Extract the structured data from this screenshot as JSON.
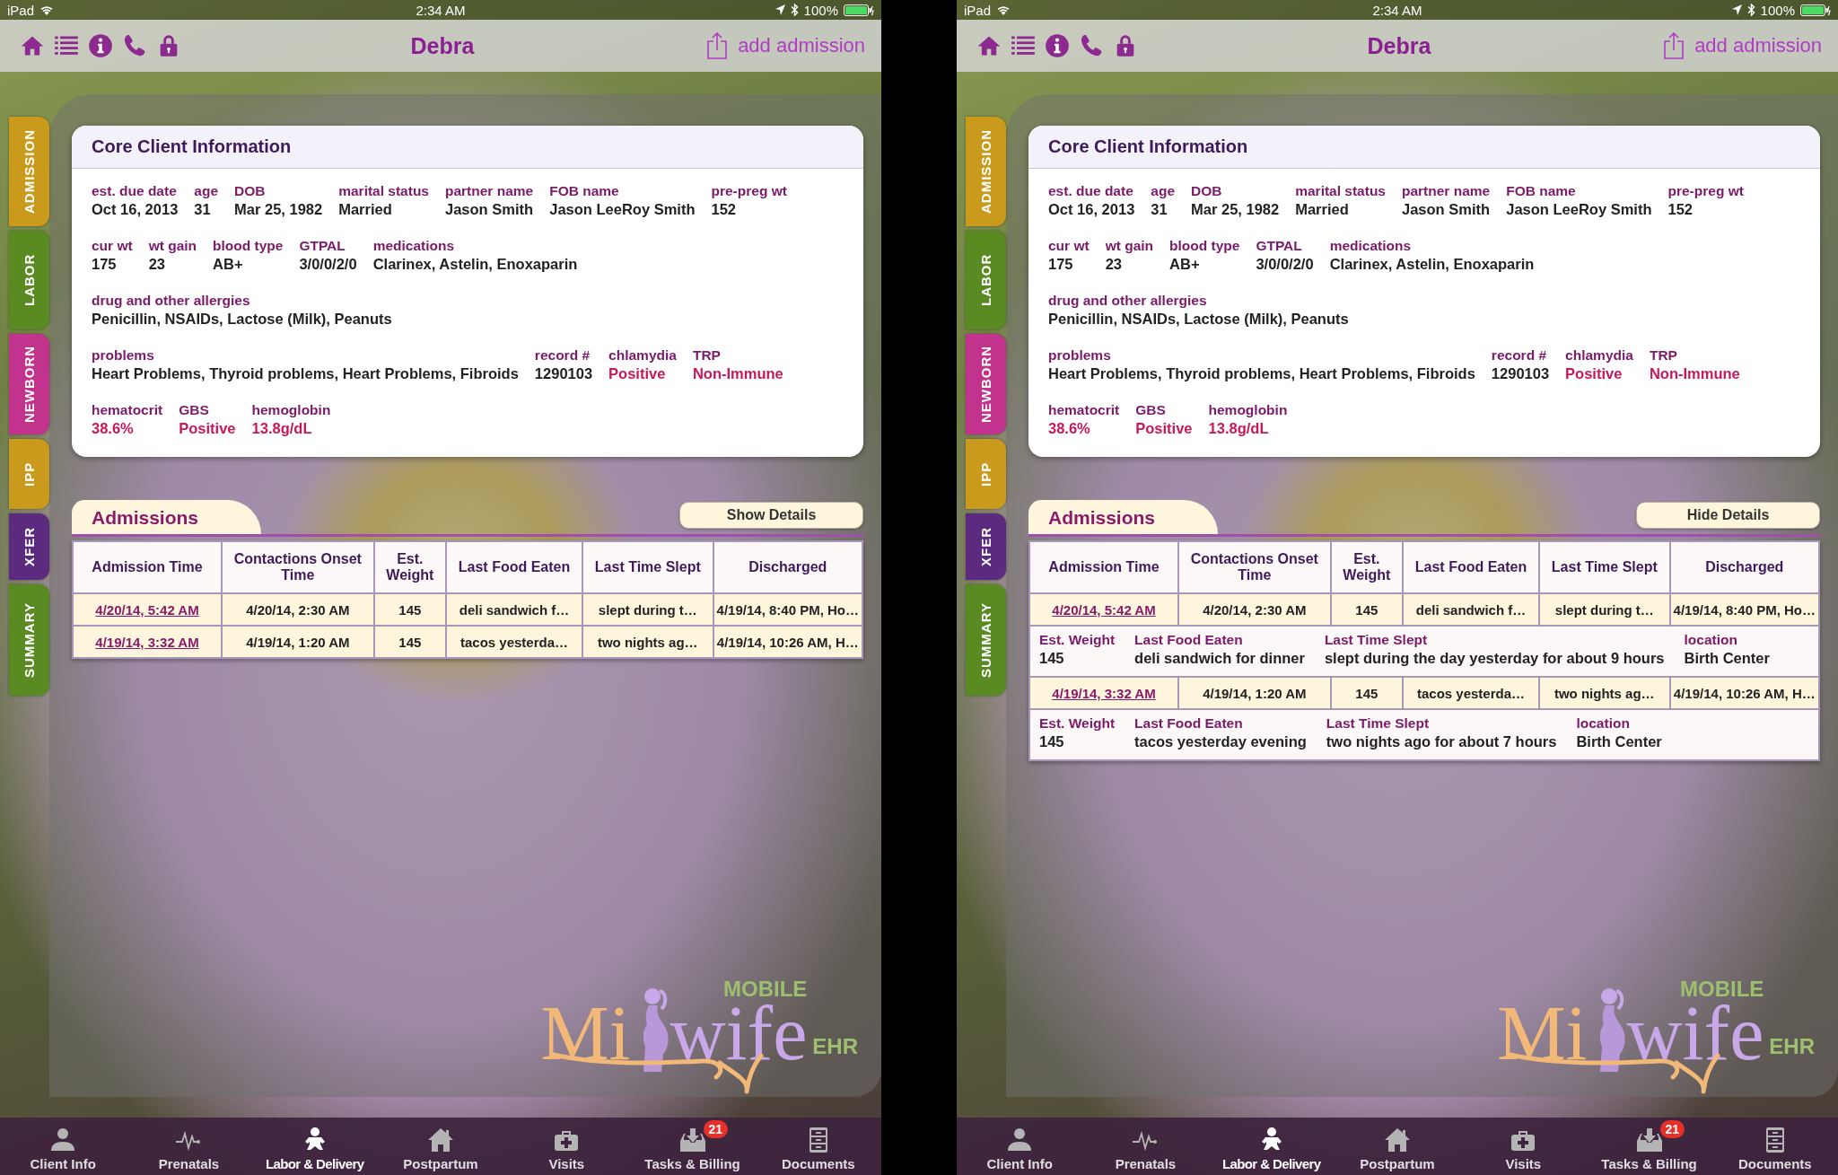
{
  "screens": [
    {
      "status_bar": {
        "device": "iPad",
        "time": "2:34 AM",
        "battery": "100%"
      },
      "nav": {
        "title": "Debra",
        "action": "add admission"
      },
      "side_tabs": [
        {
          "label": "ADMISSION",
          "color": "#c99a1c"
        },
        {
          "label": "LABOR",
          "color": "#5a8a22"
        },
        {
          "label": "NEWBORN",
          "color": "#c2338e"
        },
        {
          "label": "IPP",
          "color": "#c99a1c"
        },
        {
          "label": "XFER",
          "color": "#5c2a7e"
        },
        {
          "label": "SUMMARY",
          "color": "#5a8a22"
        }
      ],
      "core": {
        "title": "Core Client Information",
        "groups": [
          {
            "fields": [
              {
                "label": "est. due date",
                "value": "Oct 16, 2013",
                "alert": false
              },
              {
                "label": "age",
                "value": "31",
                "alert": false
              },
              {
                "label": "DOB",
                "value": "Mar 25, 1982",
                "alert": false
              },
              {
                "label": "marital status",
                "value": "Married",
                "alert": false
              },
              {
                "label": "partner name",
                "value": "Jason Smith",
                "alert": false
              },
              {
                "label": "FOB name",
                "value": "Jason LeeRoy Smith",
                "alert": false
              },
              {
                "label": "pre-preg wt",
                "value": "152",
                "alert": false
              }
            ]
          },
          {
            "fields": [
              {
                "label": "cur wt",
                "value": "175",
                "alert": false
              },
              {
                "label": "wt gain",
                "value": "23",
                "alert": false
              },
              {
                "label": "blood type",
                "value": "AB+",
                "alert": false
              },
              {
                "label": "GTPAL",
                "value": "3/0/0/2/0",
                "alert": false
              },
              {
                "label": "medications",
                "value": "Clarinex, Astelin, Enoxaparin",
                "alert": false
              }
            ]
          },
          {
            "fields": [
              {
                "label": "drug and other allergies",
                "value": "Penicillin, NSAIDs, Lactose (Milk), Peanuts",
                "alert": false
              }
            ]
          },
          {
            "fields": [
              {
                "label": "problems",
                "value": "Heart Problems, Thyroid problems, Heart Problems, Fibroids",
                "alert": false
              },
              {
                "label": "record #",
                "value": "1290103",
                "alert": false
              },
              {
                "label": "chlamydia",
                "value": "Positive",
                "alert": true
              },
              {
                "label": "TRP",
                "value": "Non-Immune",
                "alert": true
              }
            ]
          },
          {
            "fields": [
              {
                "label": "hematocrit",
                "value": "38.6%",
                "alert": true
              },
              {
                "label": "GBS",
                "value": "Positive",
                "alert": true
              },
              {
                "label": "hemoglobin",
                "value": "13.8g/dL",
                "alert": true
              }
            ]
          }
        ]
      },
      "admissions": {
        "title": "Admissions",
        "toggle": "Show Details",
        "columns": [
          "Admission Time",
          "Contactions Onset Time",
          "Est. Weight",
          "Last Food Eaten",
          "Last Time Slept",
          "Discharged"
        ],
        "rows": [
          {
            "cells": [
              "4/20/14, 5:42 AM",
              "4/20/14, 2:30 AM",
              "145",
              "deli sandwich f…",
              "slept during t…",
              "4/19/14, 8:40 PM, Ho…"
            ],
            "expanded": false
          },
          {
            "cells": [
              "4/19/14, 3:32 AM",
              "4/19/14, 1:20 AM",
              "145",
              "tacos yesterda…",
              "two nights ag…",
              "4/19/14, 10:26 AM, H…"
            ],
            "expanded": false
          }
        ]
      },
      "logo": {
        "top": "MOBILE",
        "left": "Mi",
        "right": "wife",
        "suffix": "EHR"
      },
      "tab_bar": [
        {
          "label": "Client Info",
          "selected": false
        },
        {
          "label": "Prenatals",
          "selected": false
        },
        {
          "label": "Labor & Delivery",
          "selected": true
        },
        {
          "label": "Postpartum",
          "selected": false
        },
        {
          "label": "Visits",
          "selected": false
        },
        {
          "label": "Tasks & Billing",
          "selected": false,
          "badge": "21"
        },
        {
          "label": "Documents",
          "selected": false
        }
      ]
    },
    {
      "status_bar": {
        "device": "iPad",
        "time": "2:34 AM",
        "battery": "100%"
      },
      "nav": {
        "title": "Debra",
        "action": "add admission"
      },
      "side_tabs": [
        {
          "label": "ADMISSION",
          "color": "#c99a1c"
        },
        {
          "label": "LABOR",
          "color": "#5a8a22"
        },
        {
          "label": "NEWBORN",
          "color": "#c2338e"
        },
        {
          "label": "IPP",
          "color": "#c99a1c"
        },
        {
          "label": "XFER",
          "color": "#5c2a7e"
        },
        {
          "label": "SUMMARY",
          "color": "#5a8a22"
        }
      ],
      "core": {
        "title": "Core Client Information",
        "groups": [
          {
            "fields": [
              {
                "label": "est. due date",
                "value": "Oct 16, 2013",
                "alert": false
              },
              {
                "label": "age",
                "value": "31",
                "alert": false
              },
              {
                "label": "DOB",
                "value": "Mar 25, 1982",
                "alert": false
              },
              {
                "label": "marital status",
                "value": "Married",
                "alert": false
              },
              {
                "label": "partner name",
                "value": "Jason Smith",
                "alert": false
              },
              {
                "label": "FOB name",
                "value": "Jason LeeRoy Smith",
                "alert": false
              },
              {
                "label": "pre-preg wt",
                "value": "152",
                "alert": false
              }
            ]
          },
          {
            "fields": [
              {
                "label": "cur wt",
                "value": "175",
                "alert": false
              },
              {
                "label": "wt gain",
                "value": "23",
                "alert": false
              },
              {
                "label": "blood type",
                "value": "AB+",
                "alert": false
              },
              {
                "label": "GTPAL",
                "value": "3/0/0/2/0",
                "alert": false
              },
              {
                "label": "medications",
                "value": "Clarinex, Astelin, Enoxaparin",
                "alert": false
              }
            ]
          },
          {
            "fields": [
              {
                "label": "drug and other allergies",
                "value": "Penicillin, NSAIDs, Lactose (Milk), Peanuts",
                "alert": false
              }
            ]
          },
          {
            "fields": [
              {
                "label": "problems",
                "value": "Heart Problems, Thyroid problems, Heart Problems, Fibroids",
                "alert": false
              },
              {
                "label": "record #",
                "value": "1290103",
                "alert": false
              },
              {
                "label": "chlamydia",
                "value": "Positive",
                "alert": true
              },
              {
                "label": "TRP",
                "value": "Non-Immune",
                "alert": true
              }
            ]
          },
          {
            "fields": [
              {
                "label": "hematocrit",
                "value": "38.6%",
                "alert": true
              },
              {
                "label": "GBS",
                "value": "Positive",
                "alert": true
              },
              {
                "label": "hemoglobin",
                "value": "13.8g/dL",
                "alert": true
              }
            ]
          }
        ]
      },
      "admissions": {
        "title": "Admissions",
        "toggle": "Hide Details",
        "columns": [
          "Admission Time",
          "Contactions Onset Time",
          "Est. Weight",
          "Last Food Eaten",
          "Last Time Slept",
          "Discharged"
        ],
        "rows": [
          {
            "cells": [
              "4/20/14, 5:42 AM",
              "4/20/14, 2:30 AM",
              "145",
              "deli sandwich f…",
              "slept during t…",
              "4/19/14, 8:40 PM, Ho…"
            ],
            "expanded": true,
            "details": [
              {
                "label": "Est. Weight",
                "value": "145"
              },
              {
                "label": "Last Food Eaten",
                "value": "deli sandwich for dinner"
              },
              {
                "label": "Last Time Slept",
                "value": "slept during the day yesterday for about 9 hours"
              },
              {
                "label": "location",
                "value": "Birth Center"
              }
            ]
          },
          {
            "cells": [
              "4/19/14, 3:32 AM",
              "4/19/14, 1:20 AM",
              "145",
              "tacos yesterda…",
              "two nights ag…",
              "4/19/14, 10:26 AM, H…"
            ],
            "expanded": true,
            "details": [
              {
                "label": "Est. Weight",
                "value": "145"
              },
              {
                "label": "Last Food Eaten",
                "value": "tacos yesterday evening"
              },
              {
                "label": "Last Time Slept",
                "value": "two nights ago for about 7 hours"
              },
              {
                "label": "location",
                "value": "Birth Center"
              }
            ]
          }
        ]
      },
      "logo": {
        "top": "MOBILE",
        "left": "Mi",
        "right": "wife",
        "suffix": "EHR"
      },
      "tab_bar": [
        {
          "label": "Client Info",
          "selected": false
        },
        {
          "label": "Prenatals",
          "selected": false
        },
        {
          "label": "Labor & Delivery",
          "selected": true
        },
        {
          "label": "Postpartum",
          "selected": false
        },
        {
          "label": "Visits",
          "selected": false
        },
        {
          "label": "Tasks & Billing",
          "selected": false,
          "badge": "21"
        },
        {
          "label": "Documents",
          "selected": false
        }
      ]
    }
  ]
}
